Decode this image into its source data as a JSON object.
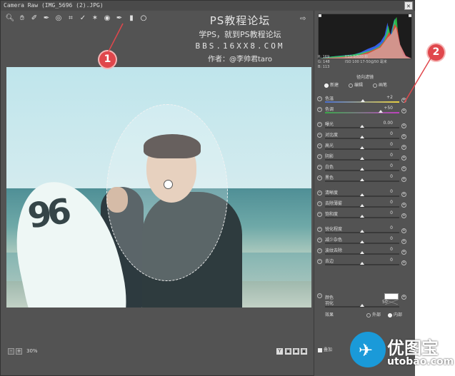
{
  "window": {
    "title": "Camera Raw (IMG_5696 (2).JPG)",
    "close_glyph": "✕"
  },
  "toolbar": {
    "icons": [
      "zoom-icon",
      "hand-icon",
      "eyedropper-icon",
      "color-sampler-icon",
      "target-adjust-icon",
      "crop-icon",
      "straighten-icon",
      "spot-removal-icon",
      "red-eye-icon",
      "brush-icon",
      "graduated-filter-icon",
      "radial-filter-icon"
    ],
    "export_icon": "open-preferences-icon"
  },
  "watermark": {
    "line1": "PS教程论坛",
    "line2": "学PS，就到PS教程论坛",
    "line3": "BBS.16XX8.COM",
    "line4": "作者：@李帅君taro"
  },
  "status": {
    "zoom": "30%"
  },
  "info": {
    "r": "R: 169",
    "g": "G: 148",
    "b": "B: 113",
    "exif1": "f/11   1/320 秒",
    "exif2": "ISO 100   17-50@50 毫米"
  },
  "panel": {
    "title": "径向滤镜",
    "mode_new": "新建",
    "mode_edit": "编辑",
    "mode_brush": "画笔",
    "sliders": [
      {
        "label": "色温",
        "value": "+2",
        "pos": 0.51,
        "track": "temp"
      },
      {
        "label": "色调",
        "value": "+50",
        "pos": 0.75,
        "track": "tint"
      },
      {
        "label": "曝光",
        "value": "0.00",
        "pos": 0.5,
        "track": "plain"
      },
      {
        "label": "对比度",
        "value": "0",
        "pos": 0.5,
        "track": "plain"
      },
      {
        "label": "高光",
        "value": "0",
        "pos": 0.5,
        "track": "plain"
      },
      {
        "label": "阴影",
        "value": "0",
        "pos": 0.5,
        "track": "plain"
      },
      {
        "label": "白色",
        "value": "0",
        "pos": 0.5,
        "track": "plain"
      },
      {
        "label": "黑色",
        "value": "0",
        "pos": 0.5,
        "track": "plain"
      },
      {
        "label": "清晰度",
        "value": "0",
        "pos": 0.5,
        "track": "plain"
      },
      {
        "label": "去除薄雾",
        "value": "0",
        "pos": 0.5,
        "track": "plain"
      },
      {
        "label": "饱和度",
        "value": "0",
        "pos": 0.5,
        "track": "plain"
      },
      {
        "label": "锐化程度",
        "value": "0",
        "pos": 0.5,
        "track": "plain"
      },
      {
        "label": "减少杂色",
        "value": "0",
        "pos": 0.5,
        "track": "plain"
      },
      {
        "label": "波纹去除",
        "value": "0",
        "pos": 0.5,
        "track": "plain"
      },
      {
        "label": "去边",
        "value": "0",
        "pos": 0.5,
        "track": "plain"
      }
    ],
    "color_label": "颜色",
    "feather_label": "羽化",
    "feather_value": "50",
    "feather_pos": 0.5,
    "effect_label": "效果",
    "effect_outside": "外部",
    "effect_inside": "内部",
    "overlay_label": "叠加"
  },
  "callouts": {
    "one": "1",
    "two": "2"
  },
  "logo": {
    "cn": "优图宝",
    "en": "utobao.com"
  },
  "colors": {
    "callout": "#e0474c",
    "logo_blue": "#1a9ad9"
  }
}
